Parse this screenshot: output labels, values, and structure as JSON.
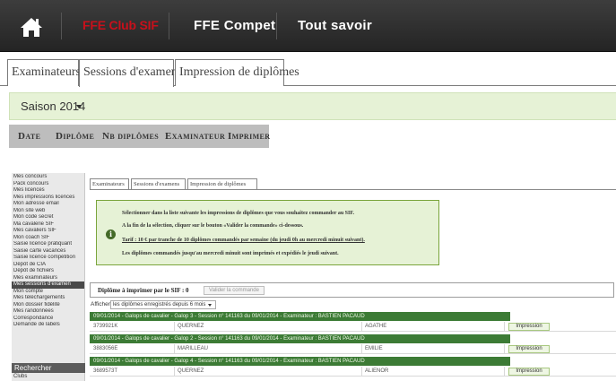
{
  "top": {
    "nav": {
      "items": [
        {
          "label": "FFE Club SIF",
          "active": true
        },
        {
          "label": "FFE Compet",
          "active": false
        },
        {
          "label": "Tout savoir",
          "active": false
        }
      ]
    },
    "tabs": [
      {
        "label": "Examinateurs",
        "active": false
      },
      {
        "label": "Sessions d'examens",
        "active": true
      },
      {
        "label": "Impression de diplômes",
        "active": false
      }
    ],
    "season": {
      "label": "Saison 2014"
    },
    "columns": [
      "Date",
      "Diplôme",
      "Nb diplômes",
      "Examinateur",
      "Imprimer"
    ]
  },
  "bottom": {
    "menu": {
      "items": [
        "Mes concours",
        "Pack concours",
        "Mes licences",
        "Mes impressions licences",
        "Mon adresse email",
        "Mon site web",
        "Mon code secret",
        "Ma cavalerie SIF",
        "Mes cavaliers SIF",
        "Mon coach SIF",
        "Saisie licence pratiquant",
        "Saisie carte vacances",
        "Saisie licence compétition",
        "Dépôt de CIA",
        "Dépôt de fichiers",
        "Mes examinateurs",
        "Mes sessions d'examen",
        "Mon compte",
        "Mes téléchargements",
        "Mon dossier fidélité",
        "Mes randonnées",
        "Correspondance",
        "Demande de labels"
      ],
      "selected_index": 16,
      "search_title": "Rechercher",
      "search_sub": "Clubs"
    },
    "tabs": [
      {
        "label": "Examinateurs"
      },
      {
        "label": "Sessions d'examens"
      },
      {
        "label": "Impression de diplômes"
      }
    ],
    "info": {
      "line1": "Sélectionner dans la liste suivante les impressions de diplômes que vous souhaitez commander au SIF.",
      "line2": "A la fin de la sélection, cliquer sur le bouton «Valider la commande» ci-dessous.",
      "line3": "Tarif : 10 € par tranche de 10 diplômes commandés par semaine (du jeudi 0h au mercredi minuit suivant).",
      "line4": "Les diplômes commandés jusqu'au mercredi minuit sont imprimés et expédiés le jeudi suivant."
    },
    "print_bar": {
      "label": "Diplôme à imprimer par le SIF : 0",
      "button": "Valider la commande"
    },
    "filter": {
      "label": "Afficher",
      "value": "les diplômes enregistrés depuis 6 mois"
    },
    "sessions": [
      {
        "header": "09/01/2014 - Galops de cavalier - Galop 3 - Session n° 141163 du 09/01/2014 - Examinateur : BASTIEN PACAUD",
        "id": "3739921K",
        "last_name": "QUERNEZ",
        "first_name": "AGATHE",
        "action": "Impression"
      },
      {
        "header": "09/01/2014 - Galops de cavalier - Galop 2 - Session n° 141163 du 09/01/2014 - Examinateur : BASTIEN PACAUD",
        "id": "3883056E",
        "last_name": "MARILLEAU",
        "first_name": "EMILIE",
        "action": "Impression"
      },
      {
        "header": "09/01/2014 - Galops de cavalier - Galop 4 - Session n° 141163 du 09/01/2014 - Examinateur : BASTIEN PACAUD",
        "id": "3689573T",
        "last_name": "QUERNEZ",
        "first_name": "ALIENOR",
        "action": "Impression"
      }
    ]
  }
}
